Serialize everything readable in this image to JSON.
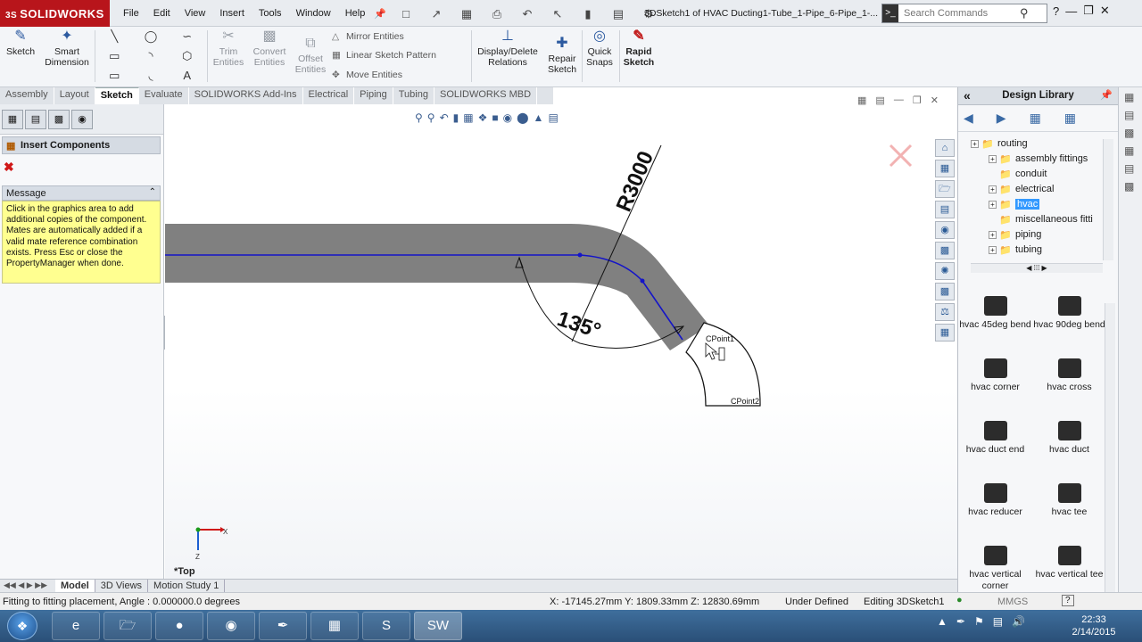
{
  "app": {
    "logo_text": "SOLIDWORKS",
    "logo_prefix": "3S",
    "document_title": "3DSketch1 of HVAC Ducting1-Tube_1-Pipe_6-Pipe_1-...",
    "menu": [
      "File",
      "Edit",
      "View",
      "Insert",
      "Tools",
      "Window",
      "Help"
    ],
    "search_placeholder": "Search Commands",
    "accent_red": "#b8151b"
  },
  "command_manager": {
    "sketch": "Sketch",
    "smart_dimension": [
      "Smart",
      "Dimension"
    ],
    "trim_entities": [
      "Trim",
      "Entities"
    ],
    "convert_entities": [
      "Convert",
      "Entities"
    ],
    "offset_entities": [
      "Offset",
      "Entities"
    ],
    "mirror_entities": "Mirror Entities",
    "linear_sketch_pattern": "Linear Sketch Pattern",
    "move_entities": "Move Entities",
    "display_delete_relations": [
      "Display/Delete",
      "Relations"
    ],
    "repair_sketch": [
      "Repair",
      "Sketch"
    ],
    "quick_snaps": [
      "Quick",
      "Snaps"
    ],
    "rapid_sketch": [
      "Rapid",
      "Sketch"
    ]
  },
  "tabs": [
    "Assembly",
    "Layout",
    "Sketch",
    "Evaluate",
    "SOLIDWORKS Add-Ins",
    "Electrical",
    "Piping",
    "Tubing",
    "SOLIDWORKS MBD"
  ],
  "active_tab": "Sketch",
  "property_manager": {
    "title": "Insert Components",
    "message_header": "Message",
    "message_body": "Click in the graphics area to add additional copies of the component. Mates are automatically added if a valid mate reference combination exists. Press Esc or close the PropertyManager when done."
  },
  "graphics": {
    "radius_label": "R3000",
    "angle_label": "135°",
    "cpoint1": "CPoint1",
    "cpoint2": "CPoint2",
    "view_label": "*Top",
    "triad_x": "X",
    "triad_z": "Z"
  },
  "design_library": {
    "title": "Design Library",
    "tree": [
      {
        "label": "routing",
        "level": 0,
        "expandable": true
      },
      {
        "label": "assembly fittings",
        "level": 1,
        "expandable": true
      },
      {
        "label": "conduit",
        "level": 1,
        "expandable": false
      },
      {
        "label": "electrical",
        "level": 1,
        "expandable": true
      },
      {
        "label": "hvac",
        "level": 1,
        "expandable": true,
        "selected": true
      },
      {
        "label": "miscellaneous fitti",
        "level": 1,
        "expandable": false
      },
      {
        "label": "piping",
        "level": 1,
        "expandable": true
      },
      {
        "label": "tubing",
        "level": 1,
        "expandable": true
      }
    ],
    "items": [
      "hvac 45deg bend",
      "hvac 90deg bend",
      "hvac corner",
      "hvac cross",
      "hvac duct end",
      "hvac duct",
      "hvac reducer",
      "hvac tee",
      "hvac vertical corner",
      "hvac vertical tee"
    ]
  },
  "bottom_tabs": [
    "Model",
    "3D Views",
    "Motion Study 1"
  ],
  "active_bottom_tab": "Model",
  "status": {
    "left": "Fitting to fitting placement,  Angle : 0.000000.0 degrees",
    "coords": "X: -17145.27mm Y: 1809.33mm Z: 12830.69mm",
    "definition": "Under Defined",
    "editing": "Editing 3DSketch1",
    "units": "MMGS"
  },
  "taskbar": {
    "time": "22:33",
    "date": "2/14/2015"
  }
}
